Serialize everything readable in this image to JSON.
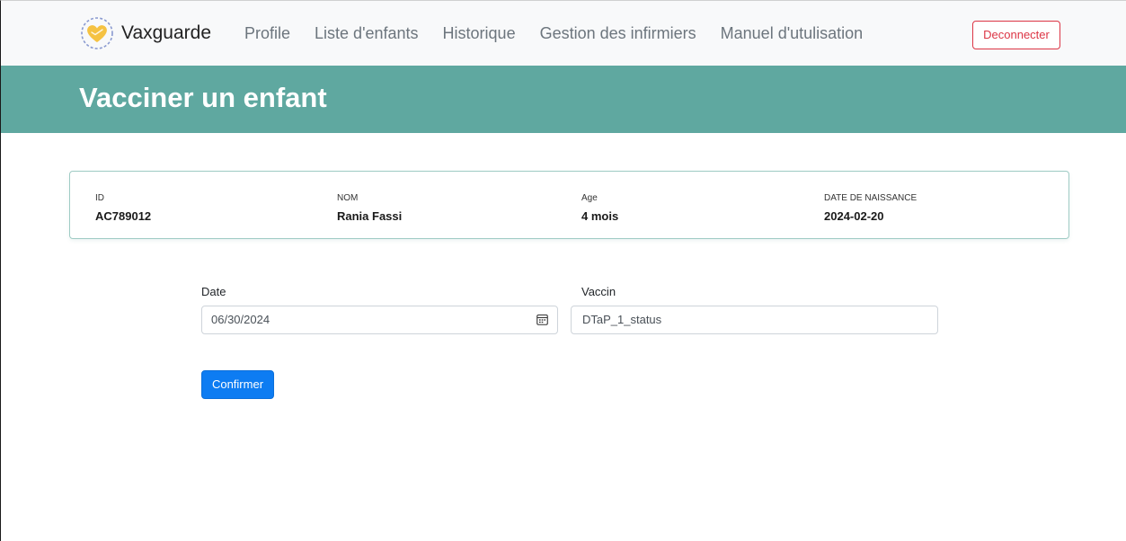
{
  "navbar": {
    "brand": "Vaxguarde",
    "links": [
      "Profile",
      "Liste d'enfants",
      "Historique",
      "Gestion des infirmiers",
      "Manuel d'utulisation"
    ],
    "logout_label": "Deconnecter"
  },
  "banner": {
    "title": "Vacciner un enfant"
  },
  "child": {
    "id_label": "ID",
    "id_value": "AC789012",
    "name_label": "NOM",
    "name_value": "Rania Fassi",
    "age_label": "Age",
    "age_value": "4 mois",
    "dob_label": "DATE DE NAISSANCE",
    "dob_value": "2024-02-20"
  },
  "form": {
    "date_label": "Date",
    "date_value": "06/30/2024",
    "vaccine_label": "Vaccin",
    "vaccine_value": "DTaP_1_status",
    "confirm_label": "Confirmer"
  },
  "colors": {
    "accent": "#5fa8a0",
    "primary": "#0d7cf2",
    "danger": "#dc3545",
    "logo_heart": "#f5c242"
  },
  "icons": {
    "brand": "heart-logo-icon",
    "date": "calendar-icon"
  }
}
